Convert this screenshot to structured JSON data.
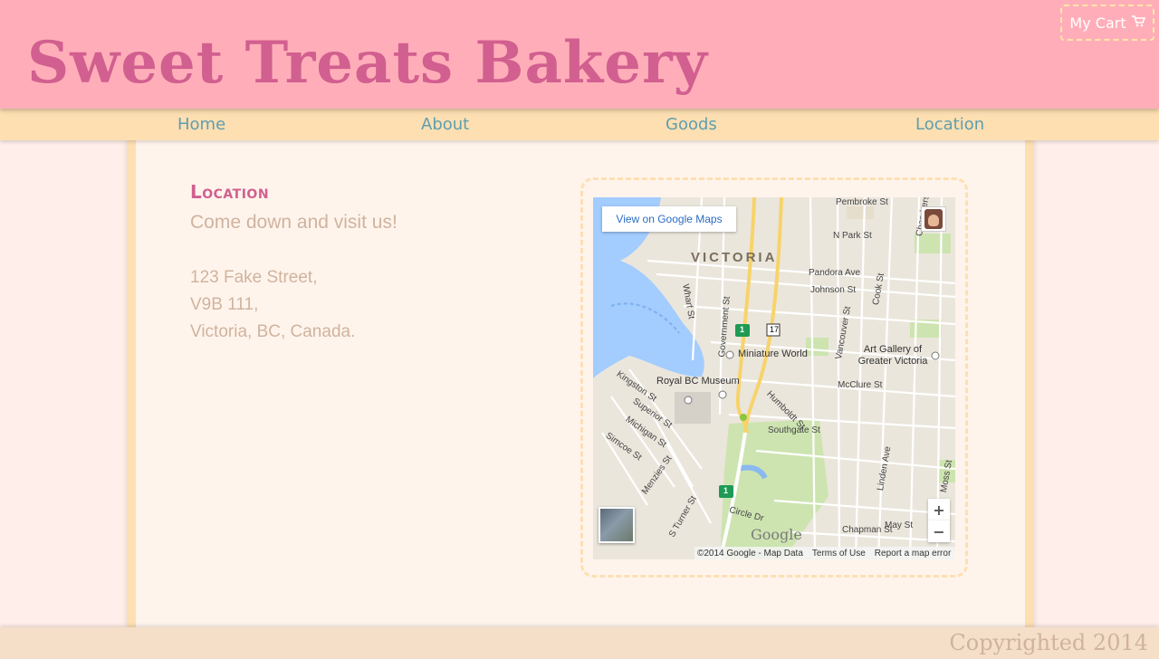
{
  "site": {
    "title": "Sweet Treats Bakery",
    "cart_label": "My Cart",
    "cart_icon": "shopping-cart-icon"
  },
  "nav": {
    "items": [
      "Home",
      "About",
      "Goods",
      "Location"
    ]
  },
  "location": {
    "heading": "Location",
    "tagline": "Come down and visit us!",
    "address": [
      "123 Fake Street,",
      "V9B 111,",
      "Victoria, BC, Canada."
    ]
  },
  "map": {
    "open_button": "View on Google Maps",
    "city_label": "VICTORIA",
    "labels": {
      "pembroke": "Pembroke St",
      "npark": "N Park St",
      "chambers": "Chambers St",
      "pandora": "Pandora Ave",
      "johnson": "Johnson St",
      "cook": "Cook St",
      "wharf": "Wharf St",
      "government": "Government St",
      "vancouver": "Vancouver St",
      "miniature": "Miniature World",
      "gallery": "Art Gallery of Greater Victoria",
      "museum": "Royal BC Museum",
      "kingston": "Kingston St",
      "superior": "Superior St",
      "michigan": "Michigan St",
      "simcoe": "Simcoe St",
      "humboldt": "Humboldt St",
      "southgate": "Southgate St",
      "mcclure": "McClure St",
      "linden": "Linden Ave",
      "moss": "Moss St",
      "menzies": "Menzies St",
      "sturner": "S Turner St",
      "circle": "Circle Dr",
      "chapman": "Chapman St",
      "may": "May St",
      "route17": "17",
      "route1": "1"
    },
    "zoom_in": "+",
    "zoom_out": "−",
    "google_logo": "Google",
    "attribution": "©2014 Google - Map Data",
    "terms": "Terms of Use",
    "report": "Report a map error"
  },
  "footer": {
    "copyright": "Copyrighted 2014"
  },
  "colors": {
    "header_bg": "#ffaeb9",
    "title": "#d15f8f",
    "nav_bg": "#fddfb2",
    "nav_text": "#5f9eae",
    "panel_bg": "#fff4ec",
    "body_text": "#d0b39e",
    "footer_bg": "#f5dfc9"
  }
}
